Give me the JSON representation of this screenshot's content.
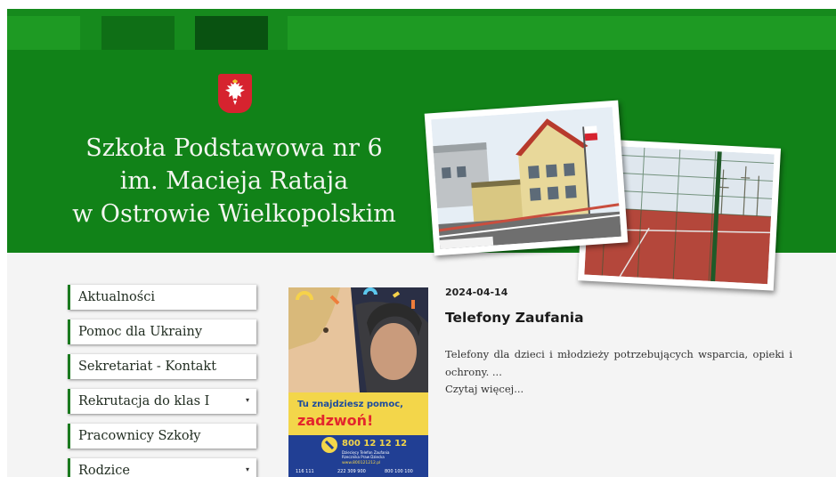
{
  "header": {
    "school_name_line1": "Szkoła Podstawowa nr 6",
    "school_name_line2": "im. Macieja Rataja",
    "school_name_line3": "w Ostrowie Wielkopolskim",
    "emblem_icon": "polish-eagle-emblem-icon",
    "brand_green": "#118218"
  },
  "menu": {
    "items": [
      {
        "label": "Aktualności",
        "has_submenu": false
      },
      {
        "label": "Pomoc dla Ukrainy",
        "has_submenu": false
      },
      {
        "label": "Sekretariat - Kontakt",
        "has_submenu": false
      },
      {
        "label": "Rekrutacja do klas I",
        "has_submenu": true
      },
      {
        "label": "Pracownicy Szkoły",
        "has_submenu": false
      },
      {
        "label": "Rodzice",
        "has_submenu": true
      }
    ],
    "submenu_caret": "▾"
  },
  "poster": {
    "headline1": "Tu znajdziesz pomoc,",
    "headline2": "zadzwoń!",
    "phone": "800 12 12 12",
    "line1": "Dziecięcy Telefon Zaufania",
    "line2": "Rzecznika Praw Dziecka",
    "website": "www.800121212.pl",
    "numbers": [
      "116 111",
      "222 309 900",
      "800 100 100"
    ]
  },
  "article": {
    "date": "2024-04-14",
    "title": "Telefony Zaufania",
    "excerpt": "Telefony dla dzieci i młodzieży potrzebujących wsparcia, opieki i ochrony. ...",
    "read_more": "Czytaj więcej..."
  }
}
